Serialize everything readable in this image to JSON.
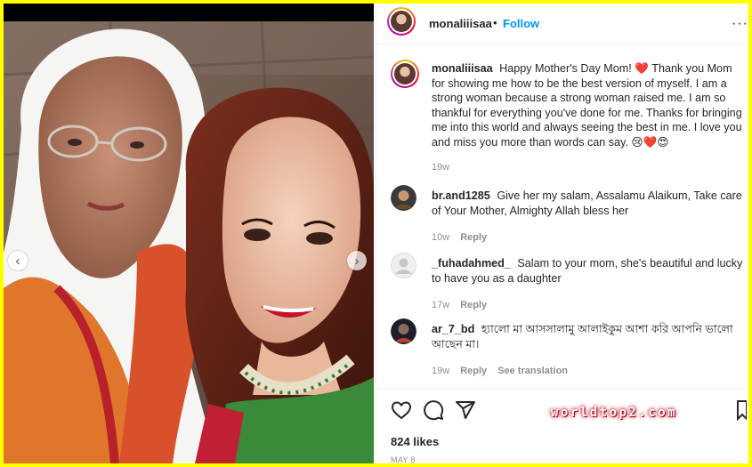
{
  "post": {
    "username": "monaliiisaa",
    "dot": "•",
    "follow_label": "Follow",
    "more_label": "···",
    "caption": {
      "username": "monaliiisaa",
      "text_a": "Happy Mother's Day Mom!",
      "emoji_heart": "❤️",
      "text_b": "Thank you Mom for showing me how to be the best version of myself. I am a strong woman because a strong woman raised me. I am so thankful for everything you've done for me. Thanks for bringing me into this world and always seeing the best in me. I love you and miss you more than words can say.",
      "emojis_end": "😢❤️😍",
      "time": "19w"
    },
    "comments": [
      {
        "username": "br.and1285",
        "text": "Give her my salam, Assalamu Alaikum, Take care of Your Mother, Almighty Allah bless her",
        "time": "10w",
        "reply": "Reply"
      },
      {
        "username": "_fuhadahmed_",
        "text": "Salam to your mom, she's beautiful and lucky to have you as a daughter",
        "time": "17w",
        "reply": "Reply"
      },
      {
        "username": "ar_7_bd",
        "text": "হ্যালো মা আসসালামু আলাইকুম আশা করি আপনি ভালো আছেন মা।",
        "time": "19w",
        "reply": "Reply",
        "see_translation": "See translation"
      }
    ],
    "likes": "824 likes",
    "date": "MAY 8",
    "watermark": "worldtop2.com"
  },
  "icons": {
    "like": "heart-icon",
    "comment": "comment-icon",
    "share": "send-icon",
    "save": "bookmark-icon",
    "prev": "chevron-left-icon",
    "next": "chevron-right-icon"
  },
  "colors": {
    "accent": "#0095f6",
    "text": "#262626",
    "muted": "#8e8e8e",
    "border_frame": "#ffff00",
    "heart": "#ed1c3a"
  }
}
